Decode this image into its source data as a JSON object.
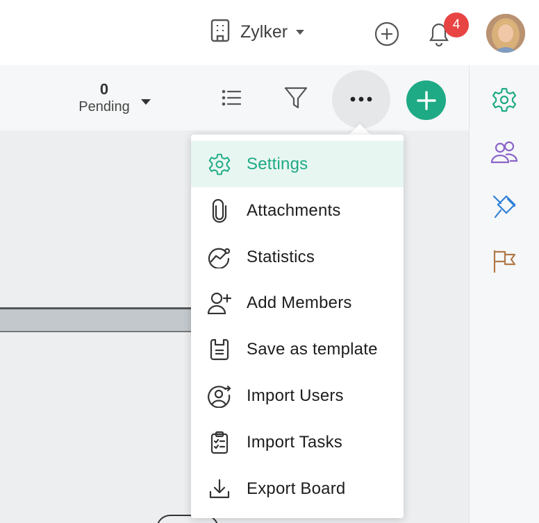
{
  "header": {
    "org_name": "Zylker",
    "notification_count": "4",
    "icons": [
      "building-icon",
      "add-circle-icon",
      "bell-icon",
      "avatar"
    ]
  },
  "toolbar": {
    "pending_count": "0",
    "pending_label": "Pending",
    "icons": [
      "list-icon",
      "filter-icon",
      "more-icon",
      "add-icon"
    ],
    "accent_color": "#1eaa85"
  },
  "menu": {
    "items": [
      {
        "label": "Settings",
        "icon": "gear-icon",
        "active": true
      },
      {
        "label": "Attachments",
        "icon": "paperclip-icon"
      },
      {
        "label": "Statistics",
        "icon": "chart-icon"
      },
      {
        "label": "Add Members",
        "icon": "add-user-icon"
      },
      {
        "label": "Save as template",
        "icon": "save-template-icon"
      },
      {
        "label": "Import Users",
        "icon": "import-users-icon"
      },
      {
        "label": "Import Tasks",
        "icon": "clipboard-icon"
      },
      {
        "label": "Export Board",
        "icon": "download-icon"
      }
    ]
  },
  "right_rail": {
    "icons": [
      "gear-icon",
      "users-icon",
      "plug-icon",
      "flag-icon"
    ],
    "colors": {
      "gear": "#1eaa85",
      "users": "#8a63c9",
      "plug": "#2d7fd6",
      "flag": "#b07a4a"
    }
  }
}
